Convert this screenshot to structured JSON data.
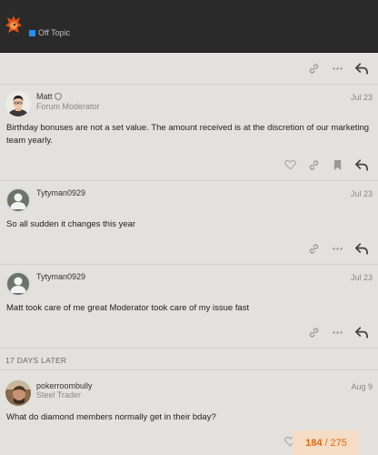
{
  "header": {
    "category_label": "Off Topic",
    "category_color": "#1e90ff"
  },
  "posts": [
    {
      "username": "Matt",
      "user_title": "Forum Moderator",
      "date": "Jul 23",
      "body": "Birthday bonuses are not a set value. The amount received is at the discretion of our marketing team yearly."
    },
    {
      "username": "Tytyman0929",
      "date": "Jul 23",
      "body": "So all sudden it changes this year"
    },
    {
      "username": "Tytyman0929",
      "date": "Jul 23",
      "body": "Matt took care of me great Moderator took care of my issue fast"
    },
    {
      "username": "pokerroombully",
      "user_title": "Steel Trader",
      "date": "Aug 9",
      "body": "What do diamond members normally get in their bday?"
    }
  ],
  "time_gap": "17 DAYS LATER",
  "progress": {
    "current": "184",
    "separator": "/",
    "total": "275"
  },
  "colors": {
    "accent": "#e06a14",
    "background": "#e2e1dd",
    "header_bg": "#2a2a2a"
  }
}
